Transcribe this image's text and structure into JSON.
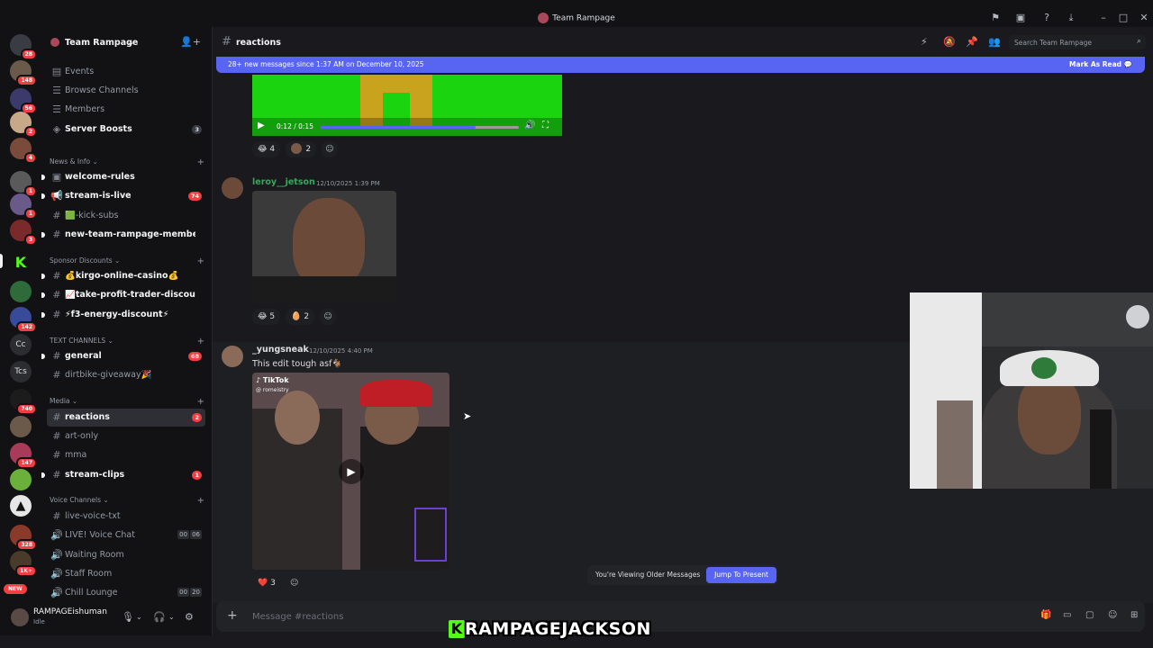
{
  "window": {
    "title": "Team Rampage"
  },
  "rail": {
    "servers": [
      {
        "badge": "28",
        "color": "#3a3c43"
      },
      {
        "badge": "148",
        "color": "#6b5a4a"
      },
      {
        "badge": "56",
        "color": "#3b3a6a"
      },
      {
        "badge": "2",
        "color": "#c7a98a"
      },
      {
        "badge": "4",
        "color": "#7a4a3a"
      },
      {
        "badge": "1",
        "color": "#5a5a5a"
      },
      {
        "badge": "1",
        "color": "#6a5a8a"
      },
      {
        "badge": "3",
        "color": "#7a2a2a"
      },
      {
        "badge": "",
        "color": "#53fc18"
      },
      {
        "badge": "",
        "color": "#2f6a3a"
      },
      {
        "badge": "142",
        "color": "#3a4a9a"
      },
      {
        "badge": "",
        "color": "#2b2d31",
        "text": "Cc"
      },
      {
        "badge": "",
        "color": "#2b2d31",
        "text": "Tcs"
      },
      {
        "badge": "740",
        "color": "#1c1c1c"
      },
      {
        "badge": "147",
        "color": "#a83a5a"
      },
      {
        "badge": "",
        "color": "#6ab03a"
      },
      {
        "badge": "",
        "color": "#e6e6e6"
      },
      {
        "badge": "328",
        "color": "#8a3a2a"
      },
      {
        "badge": "1K+",
        "color": "#4a3a2a"
      }
    ],
    "new_label": "NEW"
  },
  "server": {
    "name": "Team Rampage"
  },
  "sidebar": {
    "top_items": [
      {
        "label": "Events",
        "icon": "calendar-icon"
      },
      {
        "label": "Browse Channels",
        "icon": "browse-icon"
      },
      {
        "label": "Members",
        "icon": "members-icon"
      },
      {
        "label": "Server Boosts",
        "icon": "boost-icon",
        "count": "3"
      }
    ],
    "categories": {
      "news": "News & Info",
      "sponsor": "Sponsor Discounts",
      "text": "TEXT CHANNELS",
      "media": "Media",
      "voice": "Voice Channels"
    },
    "news_channels": [
      {
        "label": "welcome-rules",
        "count": ""
      },
      {
        "label": "stream-is-live",
        "count": "74"
      },
      {
        "label": "🟩-kick-subs",
        "count": ""
      },
      {
        "label": "new-team-rampage-members",
        "count": ""
      }
    ],
    "sponsor_channels": [
      {
        "label": "💰kirgo-online-casino💰"
      },
      {
        "label": "📈take-profit-trader-discount..."
      },
      {
        "label": "⚡f3-energy-discount⚡"
      }
    ],
    "text_channels": [
      {
        "label": "general",
        "count": "68"
      },
      {
        "label": "dirtbike-giveaway🎉",
        "count": ""
      }
    ],
    "media_channels": [
      {
        "label": "reactions",
        "count": "2"
      },
      {
        "label": "art-only",
        "count": ""
      },
      {
        "label": "mma",
        "count": ""
      },
      {
        "label": "stream-clips",
        "count": "1"
      }
    ],
    "voice_channels": [
      {
        "label": "live-voice-txt"
      },
      {
        "label": "LIVE! Voice Chat",
        "a": "00",
        "b": "06"
      },
      {
        "label": "Waiting Room"
      },
      {
        "label": "Staff Room"
      },
      {
        "label": "Chill Lounge",
        "a": "00",
        "b": "20"
      }
    ]
  },
  "user": {
    "name": "RAMPAGEishuman",
    "status": "Idle"
  },
  "channel": {
    "name": "reactions",
    "search_placeholder": "Search Team Rampage",
    "new_banner": "28+ new messages since 1:37 AM on December 10, 2025",
    "mark_read": "Mark As Read"
  },
  "messages": [
    {
      "video_time": "0:12 / 0:15",
      "progress": 0.78,
      "reactions": [
        {
          "emoji": "😂",
          "count": "4"
        },
        {
          "emoji": "👤",
          "count": "2"
        }
      ]
    },
    {
      "author": "leroy__jetson",
      "author_color": "#3ba55d",
      "timestamp": "12/10/2025 1:39 PM",
      "reactions": [
        {
          "emoji": "😂",
          "count": "5"
        },
        {
          "emoji": "🥚",
          "count": "2"
        }
      ]
    },
    {
      "author": "_yungsneak",
      "author_color": "#dbdee1",
      "timestamp": "12/10/2025 4:40 PM",
      "text": "This edit tough asf🐐",
      "tiktok": "TikTok",
      "tiktok_handle": "@ romeistry",
      "reactions": [
        {
          "emoji": "❤️",
          "count": "3"
        }
      ]
    }
  ],
  "older": {
    "text": "You're Viewing Older Messages",
    "button": "Jump To Present"
  },
  "composer": {
    "placeholder": "Message #reactions"
  },
  "overlay": {
    "k": "K",
    "text": "RAMPAGEJACKSON"
  },
  "colors": {
    "accent": "#5865f2",
    "unread_badge": "#f23f43",
    "kick_green": "#53fc18"
  }
}
